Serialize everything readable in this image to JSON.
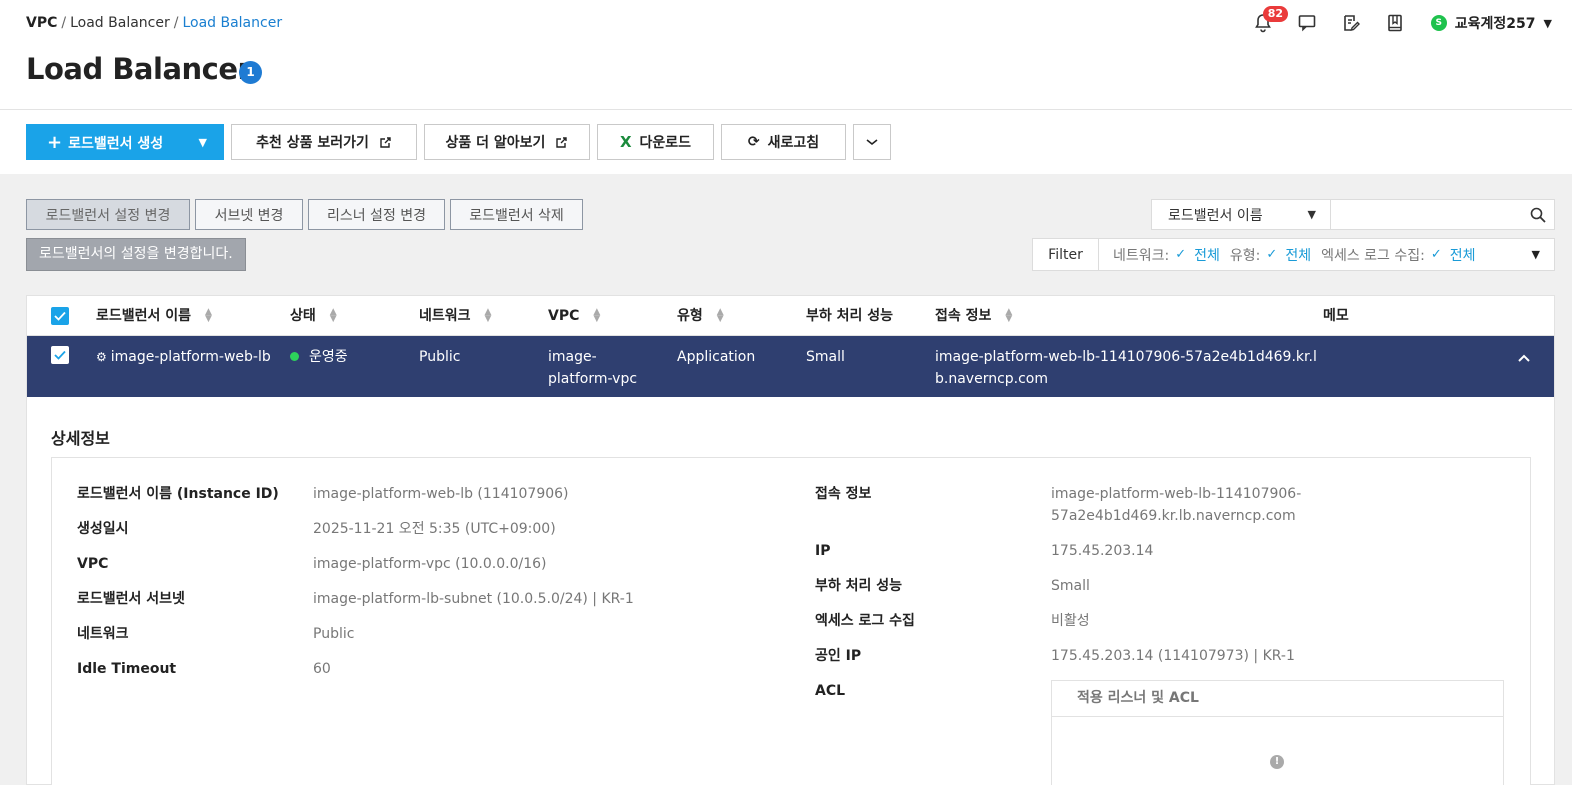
{
  "breadcrumb": {
    "root": "VPC",
    "sep": "/",
    "level1": "Load Balancer",
    "level2": "Load Balancer"
  },
  "page": {
    "title": "Load Balancer",
    "count": "1"
  },
  "header": {
    "notification_count": "82",
    "account_initial": "S",
    "account_name": "교육계정257",
    "icons": [
      "bell-icon",
      "chat-icon",
      "edit-note-icon",
      "book-icon"
    ]
  },
  "toolbar": {
    "create": "로드밸런서 생성",
    "recommend": "추천 상품 보러가기",
    "learn_more": "상품 더 알아보기",
    "download": "다운로드",
    "refresh": "새로고침"
  },
  "actions": {
    "change_settings": "로드밸런서 설정 변경",
    "change_subnet": "서브넷 변경",
    "change_listener": "리스너 설정 변경",
    "delete": "로드밸런서 삭제",
    "tooltip": "로드밸런서의 설정을 변경합니다."
  },
  "search": {
    "field": "로드밸런서 이름",
    "value": ""
  },
  "filter": {
    "label": "Filter",
    "items": [
      {
        "key": "네트워크:",
        "value": "전체"
      },
      {
        "key": "유형:",
        "value": "전체"
      },
      {
        "key": "엑세스 로그 수집:",
        "value": "전체"
      }
    ]
  },
  "table": {
    "headers": {
      "name": "로드밸런서 이름",
      "status": "상태",
      "network": "네트워크",
      "vpc": "VPC",
      "type": "유형",
      "performance": "부하 처리 성능",
      "access": "접속 정보",
      "memo": "메모"
    },
    "row": {
      "name": "image-platform-web-lb",
      "status": "운영중",
      "network": "Public",
      "vpc_line1": "image-",
      "vpc_line2": "platform-vpc",
      "type": "Application",
      "performance": "Small",
      "access_line1": "image-platform-web-lb-114107906-57a2e4b1d469.kr.l",
      "access_line2": "b.naverncp.com"
    }
  },
  "detail": {
    "title": "상세정보",
    "left": [
      {
        "label": "로드밸런서 이름 (Instance ID)",
        "value": "image-platform-web-lb (114107906)"
      },
      {
        "label": "생성일시",
        "value": "2025-11-21 오전 5:35 (UTC+09:00)"
      },
      {
        "label": "VPC",
        "value": "image-platform-vpc (10.0.0.0/16)"
      },
      {
        "label": "로드밸런서 서브넷",
        "value": "image-platform-lb-subnet (10.0.5.0/24) | KR-1"
      },
      {
        "label": "네트워크",
        "value": "Public"
      },
      {
        "label": "Idle Timeout",
        "value": "60"
      }
    ],
    "right": {
      "access_label": "접속 정보",
      "access_line1": "image-platform-web-lb-114107906-",
      "access_line2": "57a2e4b1d469.kr.lb.naverncp.com",
      "ip_label": "IP",
      "ip_value": "175.45.203.14",
      "perf_label": "부하 처리 성능",
      "perf_value": "Small",
      "log_label": "엑세스 로그 수집",
      "log_value": "비활성",
      "public_ip_label": "공인 IP",
      "public_ip_value": "175.45.203.14 (114107973) | KR-1",
      "acl_label": "ACL",
      "acl_header": "적용 리스너 및 ACL"
    }
  },
  "colors": {
    "primary": "#1aa3e8",
    "selected_row": "#2f3f70",
    "link": "#1a7fd0",
    "status_ok": "#2dd35b",
    "badge": "#ea3b3b"
  }
}
